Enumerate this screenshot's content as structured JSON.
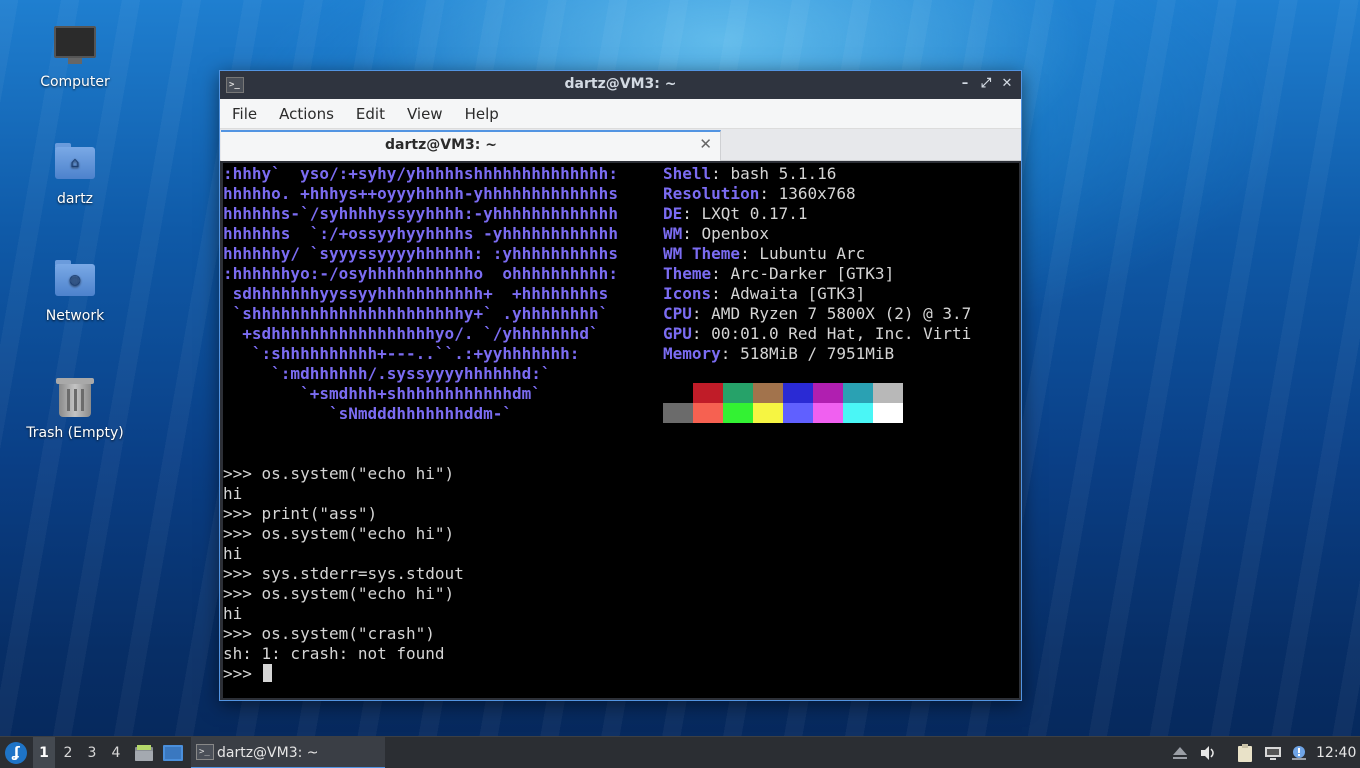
{
  "desktop": {
    "icons": [
      {
        "label": "Computer",
        "icon": "computer-icon"
      },
      {
        "label": "dartz",
        "icon": "home-folder-icon"
      },
      {
        "label": "Network",
        "icon": "network-folder-icon"
      },
      {
        "label": "Trash (Empty)",
        "icon": "trash-icon"
      }
    ]
  },
  "window": {
    "title": "dartz@VM3: ~",
    "controls": {
      "minimize": "–",
      "maximize": "⤢",
      "close": "✕"
    },
    "menu": [
      "File",
      "Actions",
      "Edit",
      "View",
      "Help"
    ],
    "tab": {
      "label": "dartz@VM3: ~",
      "close": "✕"
    }
  },
  "terminal": {
    "logo_lines": [
      ":hhhy`  yso/:+syhy/yhhhhhshhhhhhhhhhhhhh:",
      "hhhhho. +hhhys++oyyyhhhhh-yhhhhhhhhhhhhhs",
      "hhhhhhs-`/syhhhhyssyyhhhh:-yhhhhhhhhhhhhh",
      "hhhhhhs  `:/+ossyyhyyhhhhs -yhhhhhhhhhhhh",
      "hhhhhhy/ `syyyssyyyyhhhhhh: :yhhhhhhhhhhs",
      ":hhhhhhyo:-/osyhhhhhhhhhhho  ohhhhhhhhhh:",
      " sdhhhhhhhyyssyyhhhhhhhhhhh+  +hhhhhhhhs",
      " `shhhhhhhhhhhhhhhhhhhhhhy+` .yhhhhhhhh`",
      "  +sdhhhhhhhhhhhhhhhhhyo/. `/yhhhhhhhd`",
      "   `:shhhhhhhhhh+---..``.:+yyhhhhhhh:",
      "     `:mdhhhhhh/.syssyyyyhhhhhhd:`",
      "        `+smdhhh+shhhhhhhhhhhhdm`",
      "           `sNmdddhhhhhhhddm-`"
    ],
    "info": [
      {
        "key": "Shell",
        "value": "bash 5.1.16"
      },
      {
        "key": "Resolution",
        "value": "1360x768"
      },
      {
        "key": "DE",
        "value": "LXQt 0.17.1"
      },
      {
        "key": "WM",
        "value": "Openbox"
      },
      {
        "key": "WM Theme",
        "value": "Lubuntu Arc"
      },
      {
        "key": "Theme",
        "value": "Arc-Darker [GTK3]"
      },
      {
        "key": "Icons",
        "value": "Adwaita [GTK3]"
      },
      {
        "key": "CPU",
        "value": "AMD Ryzen 7 5800X (2) @ 3.7"
      },
      {
        "key": "GPU",
        "value": "00:01.0 Red Hat, Inc. Virti"
      },
      {
        "key": "Memory",
        "value": "518MiB / 7951MiB"
      }
    ],
    "palette_top": [
      "#000000",
      "#c01c28",
      "#26a269",
      "#a2734c",
      "#2a2ad4",
      "#b01fb0",
      "#2aa1b3",
      "#b8b8b8"
    ],
    "palette_bottom": [
      "#6b6b6b",
      "#f66151",
      "#33f233",
      "#f6f542",
      "#6060ff",
      "#f060f0",
      "#4af6f6",
      "#ffffff"
    ],
    "console_lines": [
      ">>> os.system(\"echo hi\")",
      "hi",
      ">>> print(\"ass\")",
      ">>> os.system(\"echo hi\")",
      "hi",
      ">>> sys.stderr=sys.stdout",
      ">>> os.system(\"echo hi\")",
      "hi",
      ">>> os.system(\"crash\")",
      "sh: 1: crash: not found"
    ],
    "prompt": ">>> "
  },
  "taskbar": {
    "main_menu_icon": "lubuntu-menu-icon",
    "workspaces": [
      "1",
      "2",
      "3",
      "4"
    ],
    "active_workspace": "1",
    "quicklaunch": [
      "file-manager-icon",
      "show-desktop-icon"
    ],
    "task_label": "dartz@VM3: ~",
    "tray": [
      "eject-icon",
      "volume-icon",
      "clipboard-icon",
      "network-icon",
      "update-notifier-icon"
    ],
    "clock": "12:40"
  }
}
